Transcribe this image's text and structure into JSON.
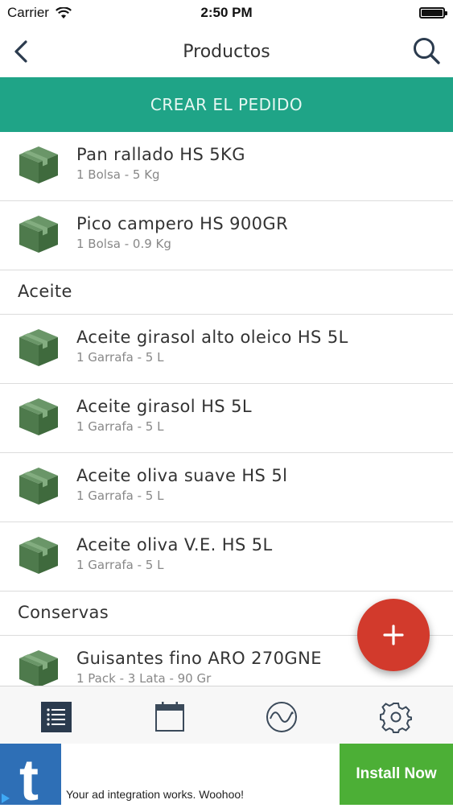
{
  "status_bar": {
    "carrier": "Carrier",
    "time": "2:50 PM"
  },
  "nav": {
    "title": "Productos",
    "back_icon": "chevron-left-icon",
    "search_icon": "search-icon"
  },
  "create_order": {
    "label": "CREAR EL PEDIDO"
  },
  "colors": {
    "accent": "#1fa487",
    "fab": "#d23a2c",
    "box": "#4e7a4c",
    "ad_button": "#4caf36",
    "ad_logo": "#2e6fb6"
  },
  "list": {
    "group0": [
      {
        "name": "Pan rallado HS 5KG",
        "detail": "1 Bolsa - 5 Kg"
      },
      {
        "name": "Pico campero HS 900GR",
        "detail": "1 Bolsa - 0.9 Kg"
      }
    ],
    "sections": [
      {
        "title": "Aceite",
        "items": [
          {
            "name": "Aceite girasol alto oleico HS 5L",
            "detail": "1 Garrafa - 5 L"
          },
          {
            "name": "Aceite girasol HS 5L",
            "detail": "1 Garrafa - 5 L"
          },
          {
            "name": "Aceite oliva suave HS 5l",
            "detail": "1 Garrafa - 5 L"
          },
          {
            "name": "Aceite oliva V.E. HS 5L",
            "detail": "1 Garrafa - 5 L"
          }
        ]
      },
      {
        "title": "Conservas",
        "items": [
          {
            "name": "Guisantes fino ARO 270GNE",
            "detail": "1 Pack - 3 Lata - 90 Gr"
          }
        ]
      }
    ]
  },
  "fab": {
    "icon": "plus-icon"
  },
  "tabs": [
    {
      "icon": "list-icon",
      "active": true
    },
    {
      "icon": "calendar-icon",
      "active": false
    },
    {
      "icon": "chart-wave-icon",
      "active": false
    },
    {
      "icon": "gear-icon",
      "active": false
    }
  ],
  "ad": {
    "message": "Your ad integration works. Woohoo!",
    "button": "Install Now",
    "logo_letter": "t"
  }
}
